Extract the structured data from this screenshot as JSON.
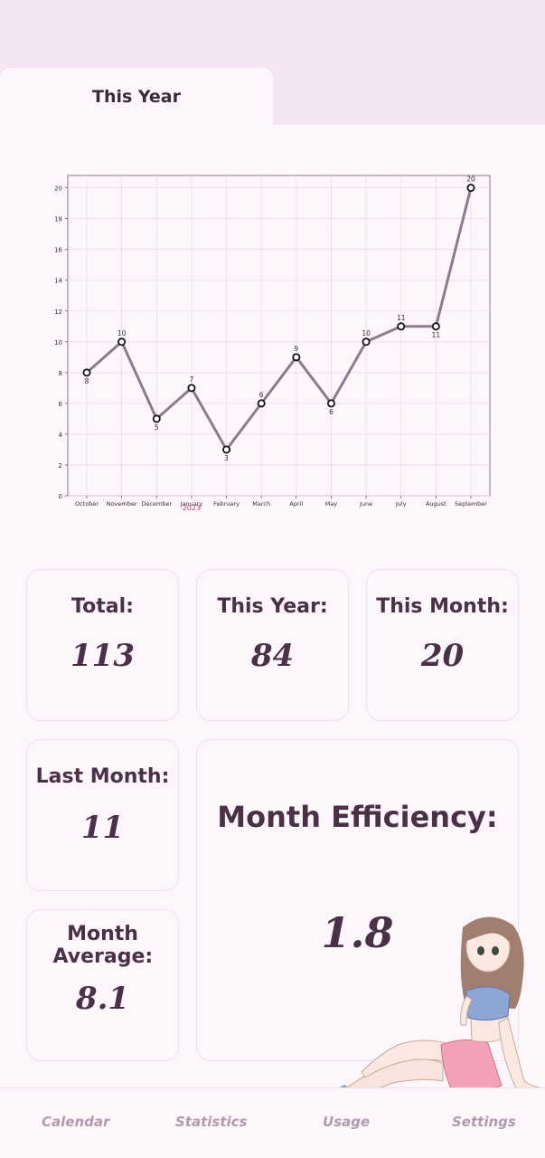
{
  "tabs": {
    "active_label": "This Year"
  },
  "chart_data": {
    "type": "line",
    "categories": [
      "October",
      "November",
      "December",
      "January",
      "February",
      "March",
      "April",
      "May",
      "June",
      "July",
      "August",
      "September"
    ],
    "values": [
      8,
      10,
      5,
      7,
      3,
      6,
      9,
      6,
      10,
      11,
      11,
      20
    ],
    "year_label": "2023",
    "yticks": [
      0,
      2,
      4,
      6,
      8,
      10,
      12,
      14,
      16,
      18,
      20
    ],
    "ylim": [
      0,
      20.8
    ],
    "grid": true,
    "line_color": "#8d7b8d"
  },
  "stats": {
    "total": {
      "label": "Total:",
      "value": "113"
    },
    "this_year": {
      "label": "This Year:",
      "value": "84"
    },
    "this_month": {
      "label": "This Month:",
      "value": "20"
    },
    "last_month": {
      "label": "Last Month:",
      "value": "11"
    },
    "month_average": {
      "label": "Month Average:",
      "value": "8.1"
    },
    "month_efficiency": {
      "label": "Month Efficiency:",
      "value": "1.8"
    }
  },
  "nav": {
    "calendar": "Calendar",
    "statistics": "Statistics",
    "usage": "Usage",
    "settings": "Settings"
  }
}
